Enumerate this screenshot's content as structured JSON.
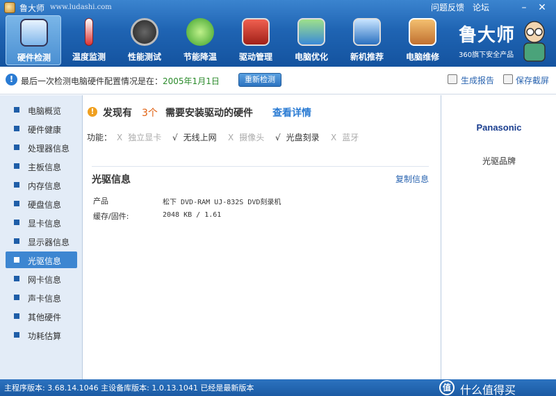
{
  "app": {
    "name": "鲁大师",
    "url": "www.ludashi.com",
    "top_links": [
      "问题反馈",
      "论坛"
    ],
    "window_controls": [
      "minimize-icon",
      "close-icon"
    ]
  },
  "nav": {
    "items": [
      {
        "label": "硬件检测",
        "icon": "monitor-magnifier-icon",
        "active": true
      },
      {
        "label": "温度监测",
        "icon": "thermometer-icon"
      },
      {
        "label": "性能测试",
        "icon": "speedometer-icon"
      },
      {
        "label": "节能降温",
        "icon": "clover-icon"
      },
      {
        "label": "驱动管理",
        "icon": "toolbox-icon"
      },
      {
        "label": "电脑优化",
        "icon": "broom-monitor-icon"
      },
      {
        "label": "新机推荐",
        "icon": "award-monitor-icon"
      },
      {
        "label": "电脑维修",
        "icon": "house-icon"
      }
    ]
  },
  "brand": {
    "name": "鲁大师",
    "sub": "360旗下安全产品"
  },
  "infobar": {
    "text": "最后一次检测电脑硬件配置情况是在：",
    "date": "2005年1月1日",
    "recheck_label": "重新检测",
    "report_label": "生成报告",
    "screenshot_label": "保存截屏"
  },
  "sidebar": {
    "items": [
      {
        "label": "电脑概览"
      },
      {
        "label": "硬件健康"
      },
      {
        "label": "处理器信息"
      },
      {
        "label": "主板信息"
      },
      {
        "label": "内存信息"
      },
      {
        "label": "硬盘信息"
      },
      {
        "label": "显卡信息"
      },
      {
        "label": "显示器信息"
      },
      {
        "label": "光驱信息",
        "active": true
      },
      {
        "label": "网卡信息"
      },
      {
        "label": "声卡信息"
      },
      {
        "label": "其他硬件"
      },
      {
        "label": "功耗估算"
      }
    ]
  },
  "main": {
    "found_prefix": "发现有",
    "found_count": "3个",
    "found_suffix": "需要安装驱动的硬件",
    "details_link": "查看详情",
    "functions_label": "功能：",
    "features": [
      {
        "mark": "X",
        "label": "独立显卡",
        "available": false
      },
      {
        "mark": "√",
        "label": "无线上网",
        "available": true
      },
      {
        "mark": "X",
        "label": "摄像头",
        "available": false
      },
      {
        "mark": "√",
        "label": "光盘刻录",
        "available": true
      },
      {
        "mark": "X",
        "label": "蓝牙",
        "available": false
      }
    ],
    "section_title": "光驱信息",
    "copy_link": "复制信息",
    "rows": [
      {
        "key": "产品",
        "value": "松下 DVD-RAM UJ-832S DVD刻录机"
      },
      {
        "key": "缓存/固件:",
        "value": "2048 KB / 1.61"
      }
    ]
  },
  "right_panel": {
    "logo_text": "Panasonic",
    "caption": "光驱品牌"
  },
  "statusbar": {
    "text": "主程序版本: 3.68.14.1046   主设备库版本: 1.0.13.1041   已经是最新版本"
  },
  "watermark": {
    "badge": "值",
    "text": "什么值得买"
  },
  "colors": {
    "header_blue": "#1f64b3",
    "accent_orange": "#e06010",
    "link_blue": "#2a7bd3",
    "date_green": "#2a8a2a"
  }
}
